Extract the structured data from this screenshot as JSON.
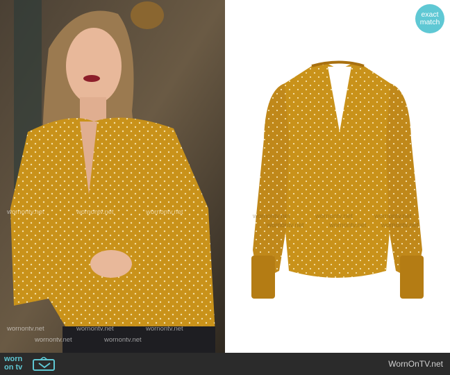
{
  "badge": {
    "line1": "exact",
    "line2": "match"
  },
  "watermark": "wornontv.net",
  "footer": {
    "logo_line1": "worn",
    "logo_line2": "on tv",
    "site_name": "WornOnTV.net"
  },
  "colors": {
    "mustard": "#c9921a",
    "badge": "#5fc8d4",
    "footer_bg": "#2b2b2b"
  }
}
